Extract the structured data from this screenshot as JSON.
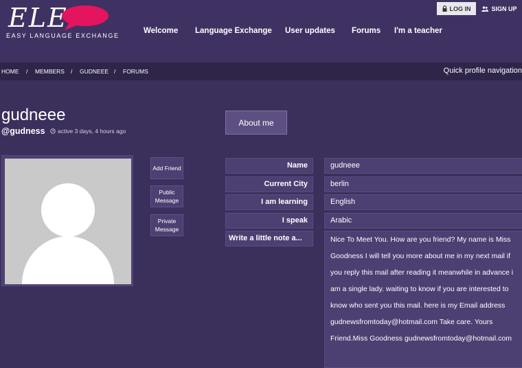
{
  "header": {
    "logo_text": "ELE",
    "logo_subtitle": "EASY LANGUAGE EXCHANGE",
    "colors": {
      "header_bg": "#3f3263",
      "logo_bubble": "#e5145e",
      "page_bg": "#3b2f5c"
    }
  },
  "nav": {
    "items": [
      {
        "label": "Welcome"
      },
      {
        "label": "Language Exchange"
      },
      {
        "label": "User updates"
      },
      {
        "label": "Forums"
      },
      {
        "label": "I'm a teacher"
      }
    ]
  },
  "auth": {
    "login_label": "LOG IN",
    "login_icon": "lock-icon",
    "signup_label": "SIGN UP",
    "signup_icon": "users-icon"
  },
  "breadcrumb": {
    "items": [
      "HOME",
      "MEMBERS",
      "GUDNEEE",
      "FORUMS"
    ],
    "separator": "/",
    "quick_nav": "Quick profile navigation"
  },
  "profile": {
    "display_name": "gudneee",
    "handle": "@gudness",
    "activity": "active 3 days, 4 hours ago",
    "activity_icon": "clock-icon",
    "about_button": "About me",
    "actions": {
      "add_friend": "Add Friend",
      "public_message": "Public Message",
      "private_message": "Private Message"
    }
  },
  "details": {
    "rows": [
      {
        "label": "Name",
        "value": "gudneee"
      },
      {
        "label": "Current City",
        "value": "berlin"
      },
      {
        "label": "I am learning",
        "value": "English"
      },
      {
        "label": "I speak",
        "value": "Arabic"
      },
      {
        "label": "Write a little note a...",
        "value": "Nice To Meet You. How are you friend? My name is Miss Goodness I will tell you more about me in my next mail if you reply this mail after reading it meanwhile in advance i am a single lady. waiting to know if you are interested to know who sent you this mail. here is my Email address gudnewsfromtoday@hotmail.com Take care. Yours Friend.Miss Goodness gudnewsfromtoday@hotmail.com"
      }
    ]
  }
}
